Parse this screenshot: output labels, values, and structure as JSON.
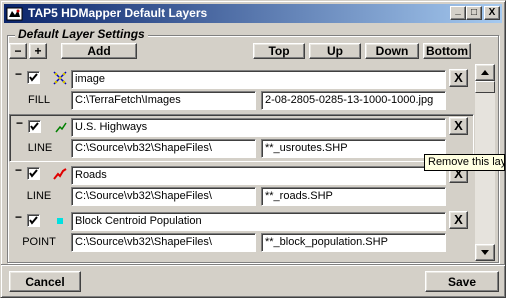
{
  "window": {
    "title": "TAP5 HDMapper Default Layers",
    "minimize_glyph": "_",
    "maximize_glyph": "□",
    "close_glyph": "X"
  },
  "group": {
    "title": "Default Layer Settings"
  },
  "toolbar": {
    "collapse_label": "−",
    "expand_label": "+",
    "add_label": "Add",
    "top_label": "Top",
    "up_label": "Up",
    "down_label": "Down",
    "bottom_label": "Bottom"
  },
  "layers": [
    {
      "collapse": "−",
      "checked": true,
      "icon": "image-layer-icon",
      "name": "image",
      "type": "FILL",
      "path": "C:\\TerraFetch\\Images",
      "file": "2-08-2805-0285-13-1000-1000.jpg",
      "remove": "X",
      "selected": false
    },
    {
      "collapse": "−",
      "checked": true,
      "icon": "green-line-icon",
      "name": "U.S. Highways",
      "type": "LINE",
      "path": "C:\\Source\\vb32\\ShapeFiles\\",
      "file": "**_usroutes.SHP",
      "remove": "X",
      "selected": true
    },
    {
      "collapse": "−",
      "checked": true,
      "icon": "red-line-icon",
      "name": "Roads",
      "type": "LINE",
      "path": "C:\\Source\\vb32\\ShapeFiles\\",
      "file": "**_roads.SHP",
      "remove": "X",
      "selected": false
    },
    {
      "collapse": "−",
      "checked": true,
      "icon": "cyan-point-icon",
      "name": "Block Centroid Population",
      "type": "POINT",
      "path": "C:\\Source\\vb32\\ShapeFiles\\",
      "file": "**_block_population.SHP",
      "remove": "X",
      "selected": false
    }
  ],
  "tooltip": "Remove this laye",
  "footer": {
    "cancel_label": "Cancel",
    "save_label": "Save"
  },
  "colors": {
    "titlebar_start": "#0a246a",
    "titlebar_end": "#a6caf0",
    "face": "#d4d0c8"
  }
}
